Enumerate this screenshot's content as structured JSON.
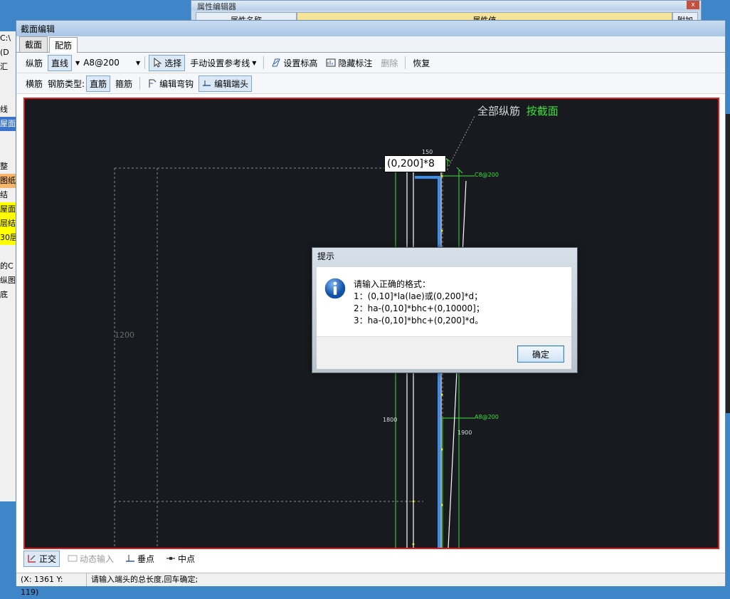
{
  "background": {
    "prop_editor_title": "属性编辑器",
    "prop_col_name": "属性名称",
    "prop_col_value": "属性值",
    "prop_col_extra": "附加",
    "close_glyph": "x",
    "left_items": [
      "C:\\",
      "(D",
      "汇",
      "",
      "",
      "线",
      "屋面",
      "",
      "",
      "整",
      "图纸",
      "结",
      "屋面",
      "层结",
      "30层",
      "",
      "的C",
      "纵图",
      "底"
    ]
  },
  "window": {
    "title": "截面编辑",
    "tabs": [
      {
        "label": "截面"
      },
      {
        "label": "配筋"
      }
    ]
  },
  "toolbar1": {
    "longitudinal_label": "纵筋",
    "line_type": "直线",
    "spec": "A8@200",
    "select": "选择",
    "manual_ref": "手动设置参考线",
    "set_elevation": "设置标高",
    "hide_annotation": "隐藏标注",
    "delete": "删除",
    "restore": "恢复"
  },
  "toolbar2": {
    "transverse_label": "横筋",
    "rebar_type_label": "钢筋类型:",
    "straight": "直筋",
    "stirrup": "箍筋",
    "edit_hook": "编辑弯钩",
    "edit_end": "编辑端头"
  },
  "canvas": {
    "input_value": "(0,200]*8",
    "all_long_label": "全部纵筋",
    "by_section": "按截面",
    "dim_150": "150",
    "dim_c8": "C8@200",
    "dim_a8": "A8@200",
    "dim_1200": "1200",
    "dim_1800": "1800",
    "dim_1900": "1900"
  },
  "dialog": {
    "title": "提示",
    "line1": "请输入正确的格式：",
    "line2": "1：(0,10]*la(lae)或(0,200]*d；",
    "line3": "2：ha-(0,10]*bhc+(0,10000]；",
    "line4": "3：ha-(0,10]*bhc+(0,200]*d。",
    "ok": "确定"
  },
  "bottom": {
    "ortho": "正交",
    "dynamic_input": "动态输入",
    "perpendicular": "垂点",
    "midpoint": "中点"
  },
  "status": {
    "coords": "(X: 1361 Y: 119)",
    "message": "请输入端头的总长度,回车确定;"
  },
  "colors": {
    "canvas_bg": "#181a1f",
    "canvas_border": "#e31b1b",
    "green": "#3be03b",
    "rebar_blue": "#3a8de8"
  }
}
